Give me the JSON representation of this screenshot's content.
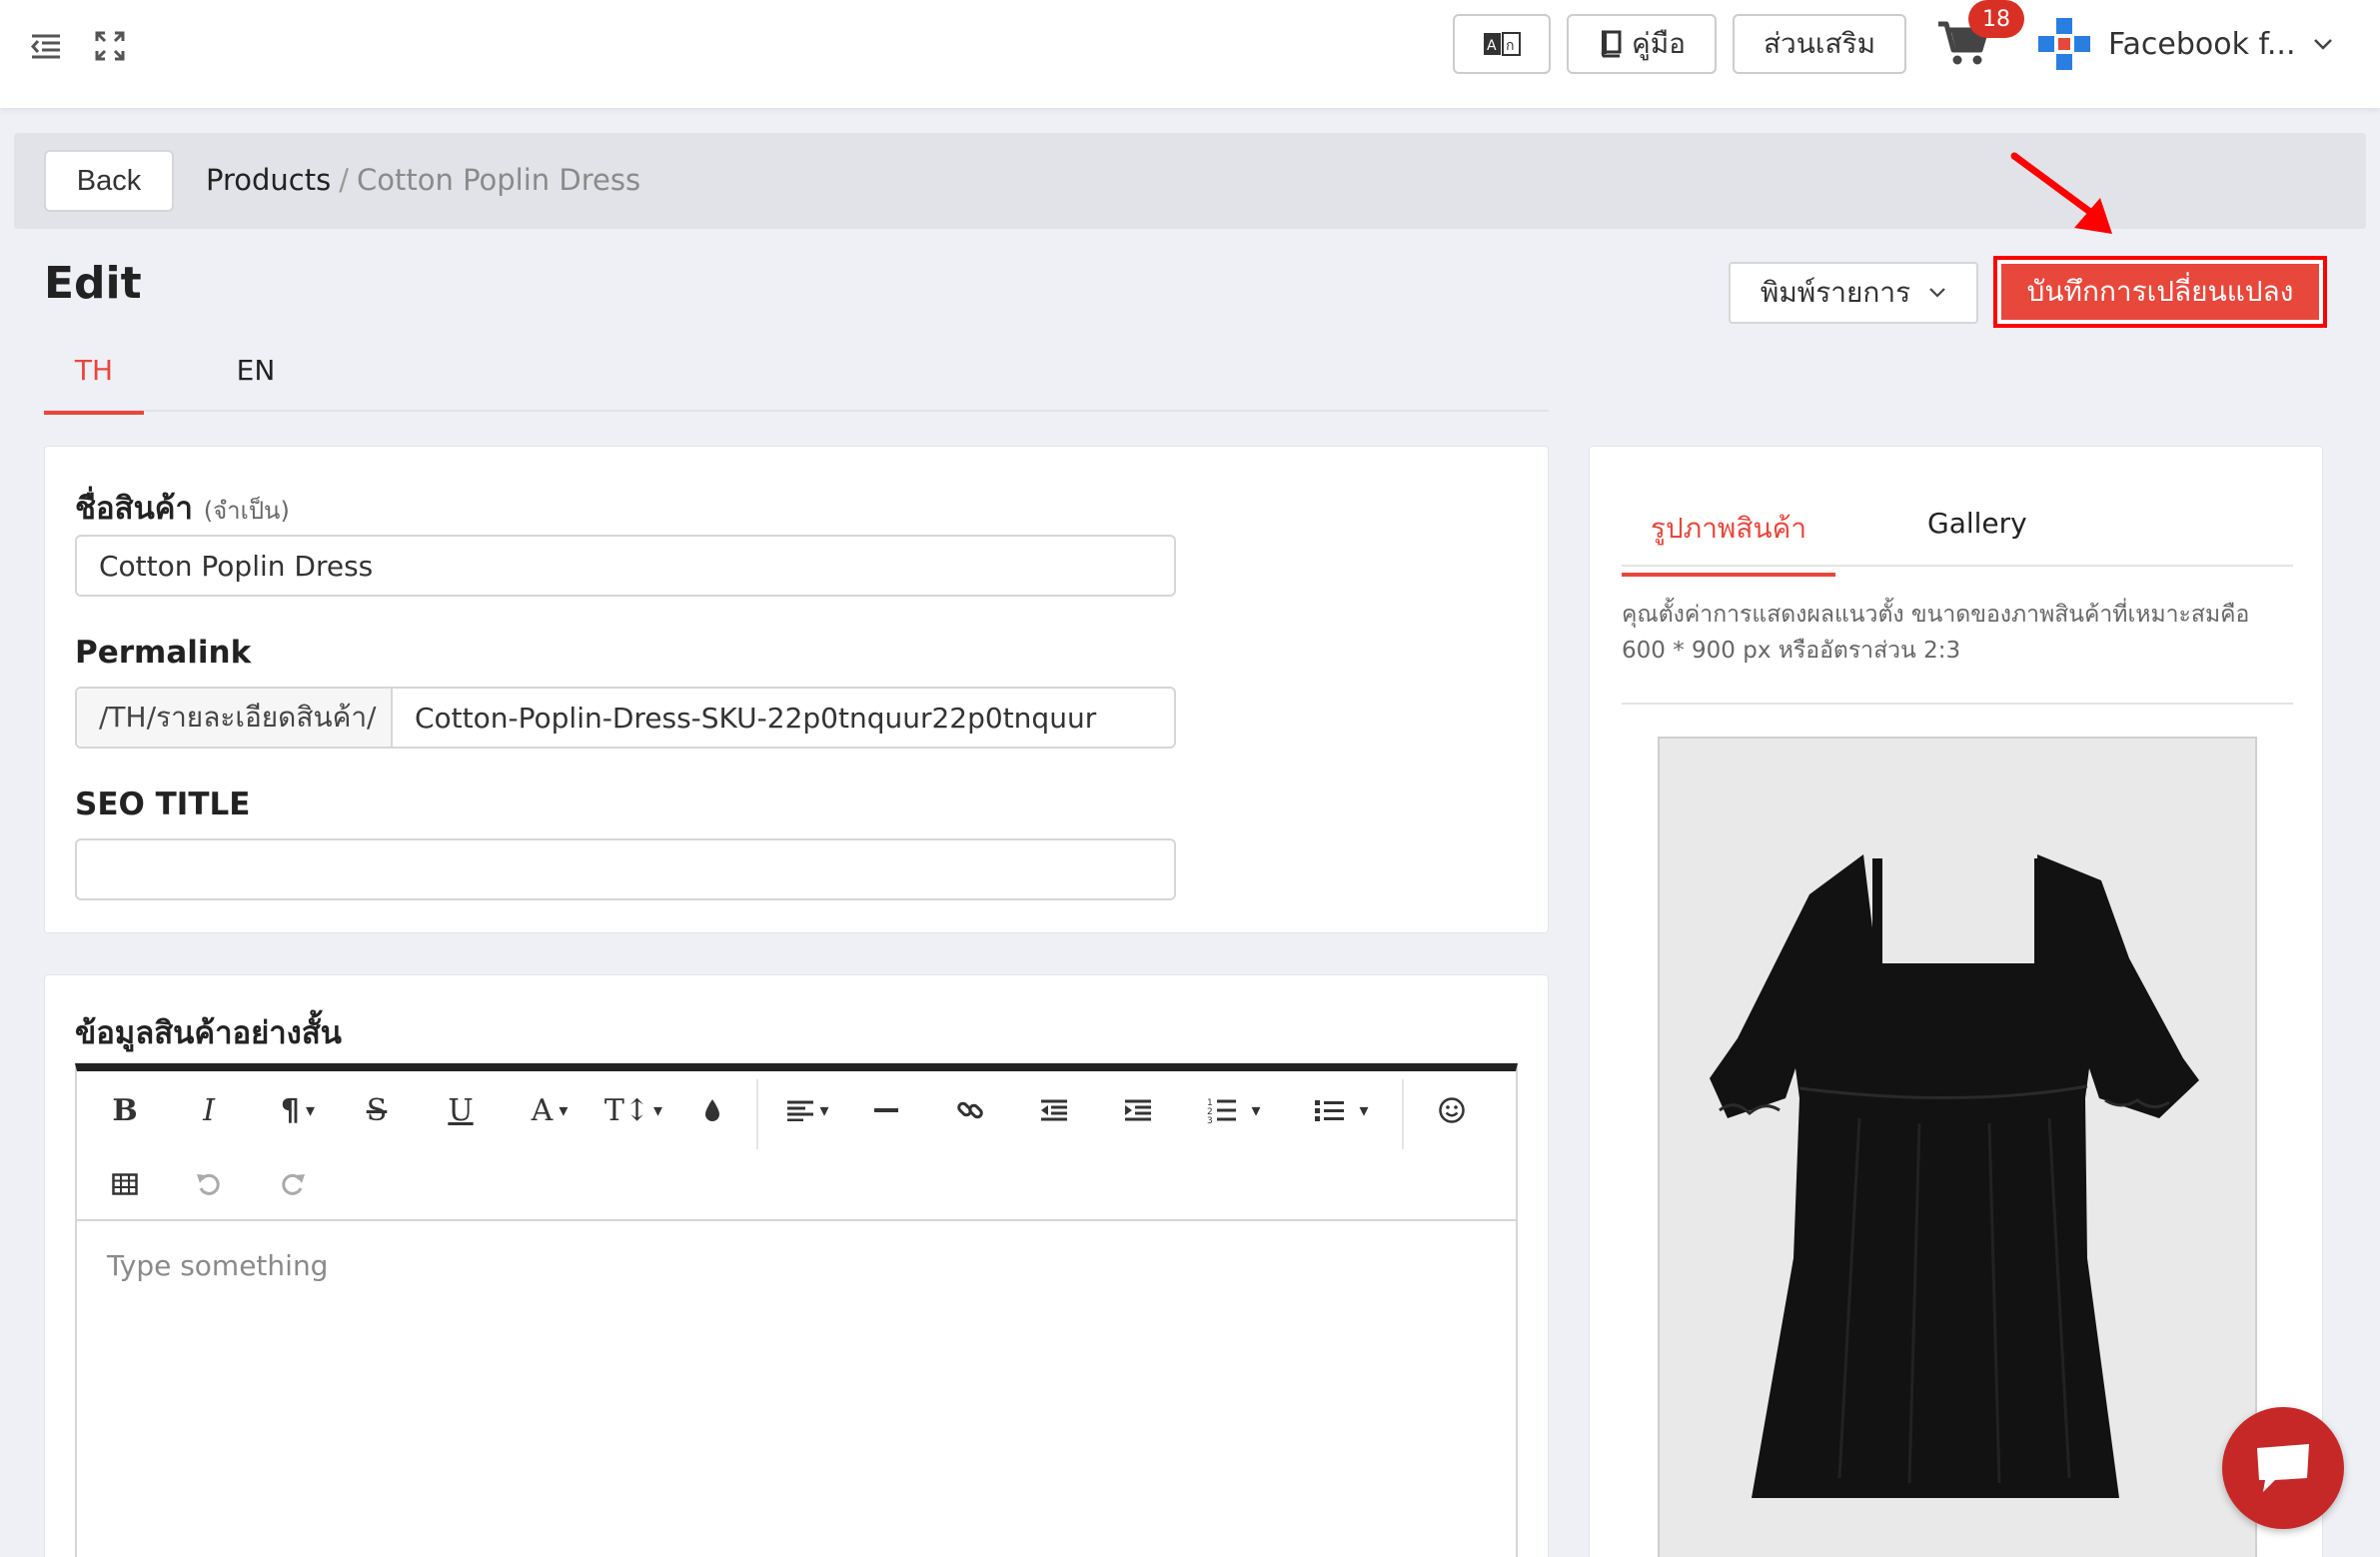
{
  "topbar": {
    "translate_label": "",
    "manual_label": "คู่มือ",
    "addons_label": "ส่วนเสริม",
    "cart_count": "18",
    "account_name": "Facebook f..."
  },
  "breadcrumb": {
    "back_label": "Back",
    "parent": "Products",
    "separator": "/",
    "current": "Cotton Poplin Dress"
  },
  "header": {
    "title": "Edit",
    "print_label": "พิมพ์รายการ",
    "save_label": "บันทึกการเปลี่ยนแปลง"
  },
  "tabs": [
    {
      "label": "TH",
      "active": true
    },
    {
      "label": "EN",
      "active": false
    }
  ],
  "form": {
    "name_label": "ชื่อสินค้า",
    "name_required": "(จำเป็น)",
    "name_value": "Cotton Poplin Dress",
    "permalink_label": "Permalink",
    "permalink_prefix": "/TH/รายละเอียดสินค้า/",
    "permalink_value": "Cotton-Poplin-Dress-SKU-22p0tnquur22p0tnquur",
    "seo_title_label": "SEO TITLE",
    "seo_title_value": ""
  },
  "short_desc": {
    "label": "ข้อมูลสินค้าอย่างสั้น",
    "placeholder": "Type something"
  },
  "toolbar_tools": [
    "bold",
    "italic",
    "paragraph",
    "strikethrough",
    "underline",
    "font-color",
    "font-size",
    "color-fill",
    "align",
    "horizontal-rule",
    "link",
    "outdent",
    "indent",
    "ordered-list",
    "unordered-list",
    "emoticon",
    "table",
    "undo",
    "redo"
  ],
  "image_panel": {
    "tab_product_image": "รูปภาพสินค้า",
    "tab_gallery": "Gallery",
    "hint": "คุณตั้งค่าการแสดงผลแนวตั้ง ขนาดของภาพสินค้าที่เหมาะสมคือ 600 * 900 px หรืออัตราส่วน 2:3"
  },
  "colors": {
    "accent": "#e8473b",
    "badge": "#d93025",
    "chat": "#c62828"
  }
}
